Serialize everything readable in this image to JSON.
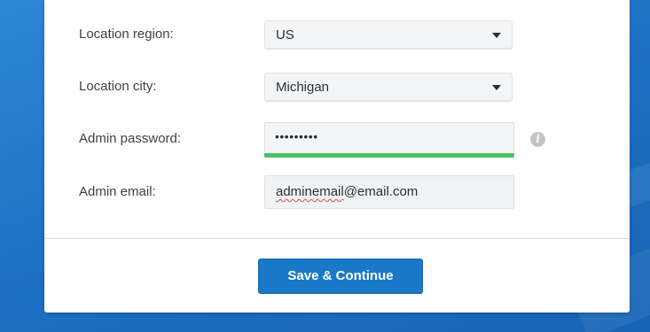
{
  "form": {
    "location_region": {
      "label": "Location region:",
      "value": "US",
      "icon": "chevron-down-icon"
    },
    "location_city": {
      "label": "Location city:",
      "value": "Michigan",
      "icon": "chevron-down-icon"
    },
    "admin_password": {
      "label": "Admin password:",
      "masked_value": "•••••••••",
      "strength_color": "#4fc067",
      "info_icon": "info-icon",
      "info_glyph": "i"
    },
    "admin_email": {
      "label": "Admin email:",
      "value_underlined": "adminemail",
      "value_rest": "@email.com"
    }
  },
  "actions": {
    "save_continue_label": "Save & Continue"
  },
  "colors": {
    "accent": "#1a78c9",
    "background": "#2f86d6",
    "success": "#4fc067"
  }
}
